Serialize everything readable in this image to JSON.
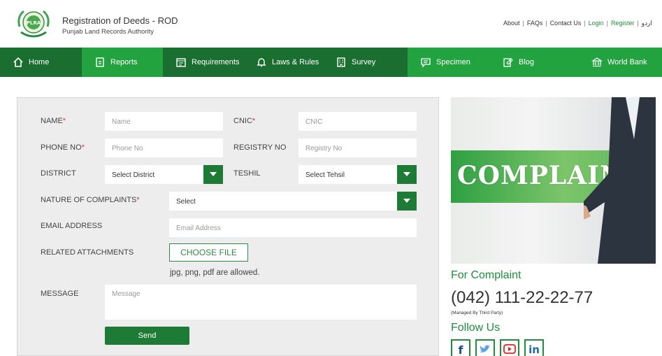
{
  "header": {
    "title": "Registration of Deeds - ROD",
    "subtitle": "Punjab Land Records Authority",
    "logo_text": "PLRA",
    "links": [
      {
        "label": "About"
      },
      {
        "label": "FAQs"
      },
      {
        "label": "Contact Us"
      },
      {
        "label": "Login"
      },
      {
        "label": "Register"
      },
      {
        "label": "اردو"
      }
    ]
  },
  "nav": {
    "items": [
      {
        "label": "Home",
        "icon": "home-icon"
      },
      {
        "label": "Reports",
        "icon": "reports-icon"
      },
      {
        "label": "Requirements",
        "icon": "requirements-icon"
      },
      {
        "label": "Laws & Rules",
        "icon": "bell-icon"
      },
      {
        "label": "Survey",
        "icon": "building-icon"
      },
      {
        "label": "Specimen",
        "icon": "message-icon"
      },
      {
        "label": "Blog",
        "icon": "edit-icon"
      },
      {
        "label": "World Bank",
        "icon": "bank-icon"
      }
    ]
  },
  "form": {
    "name_label": "NAME",
    "name_placeholder": "Name",
    "cnic_label": "CNIC",
    "cnic_placeholder": "CNIC",
    "phone_label": "PHONE NO",
    "phone_placeholder": "Phone No",
    "registry_label": "REGISTRY NO",
    "registry_placeholder": "Registry No",
    "district_label": "DISTRICT",
    "district_value": "Select District",
    "tehsil_label": "TESHIL",
    "tehsil_value": "Select Tehsil",
    "nature_label": "NATURE OF COMPLAINTS",
    "nature_value": "Select",
    "email_label": "EMAIL ADDRESS",
    "email_placeholder": "Email Address",
    "attachments_label": "RELATED ATTACHMENTS",
    "choose_file": "CHOOSE FILE",
    "file_hint": "jpg, png, pdf are allowed.",
    "message_label": "MESSAGE",
    "message_placeholder": "Message",
    "send_label": "Send",
    "required_mark": "*"
  },
  "sidebar": {
    "banner_text": "COMPLAINT",
    "for_complaint": "For Complaint",
    "phone": "(042) 111-22-22-77",
    "managed": "(Managed By Third Party)",
    "follow_us": "Follow Us",
    "social": [
      "facebook-icon",
      "twitter-icon",
      "youtube-icon",
      "linkedin-icon"
    ]
  },
  "colors": {
    "dark_green": "#1a6e30",
    "bright_green": "#22a33f",
    "accent_green": "#1f8d3c",
    "required_red": "#d9363e"
  }
}
